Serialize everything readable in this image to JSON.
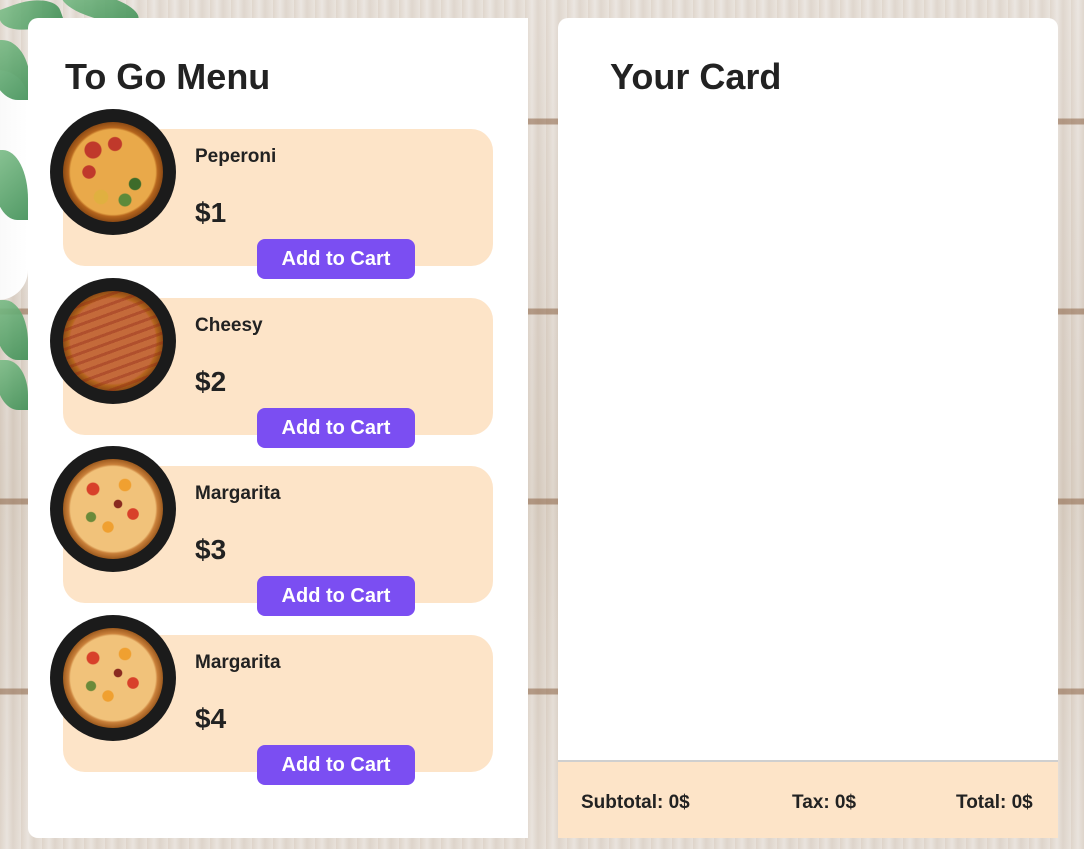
{
  "menu": {
    "title": "To Go Menu",
    "items": [
      {
        "name": "Peperoni",
        "price": "$1",
        "button_label": "Add to Cart",
        "image_icon": "pepperoni-pizza-image"
      },
      {
        "name": "Cheesy",
        "price": "$2",
        "button_label": "Add to Cart",
        "image_icon": "cheesy-pizza-image"
      },
      {
        "name": "Margarita",
        "price": "$3",
        "button_label": "Add to Cart",
        "image_icon": "margarita-pizza-image"
      },
      {
        "name": "Margarita",
        "price": "$4",
        "button_label": "Add to Cart",
        "image_icon": "margarita-pizza-image"
      }
    ]
  },
  "cart": {
    "title": "Your Card",
    "subtotal": "Subtotal: 0$",
    "tax": "Tax: 0$",
    "total": "Total: 0$"
  },
  "colors": {
    "accent": "#7b4ef2",
    "card_background": "#fde4c8",
    "panel_background": "#ffffff",
    "plate": "#1b1b1b"
  }
}
